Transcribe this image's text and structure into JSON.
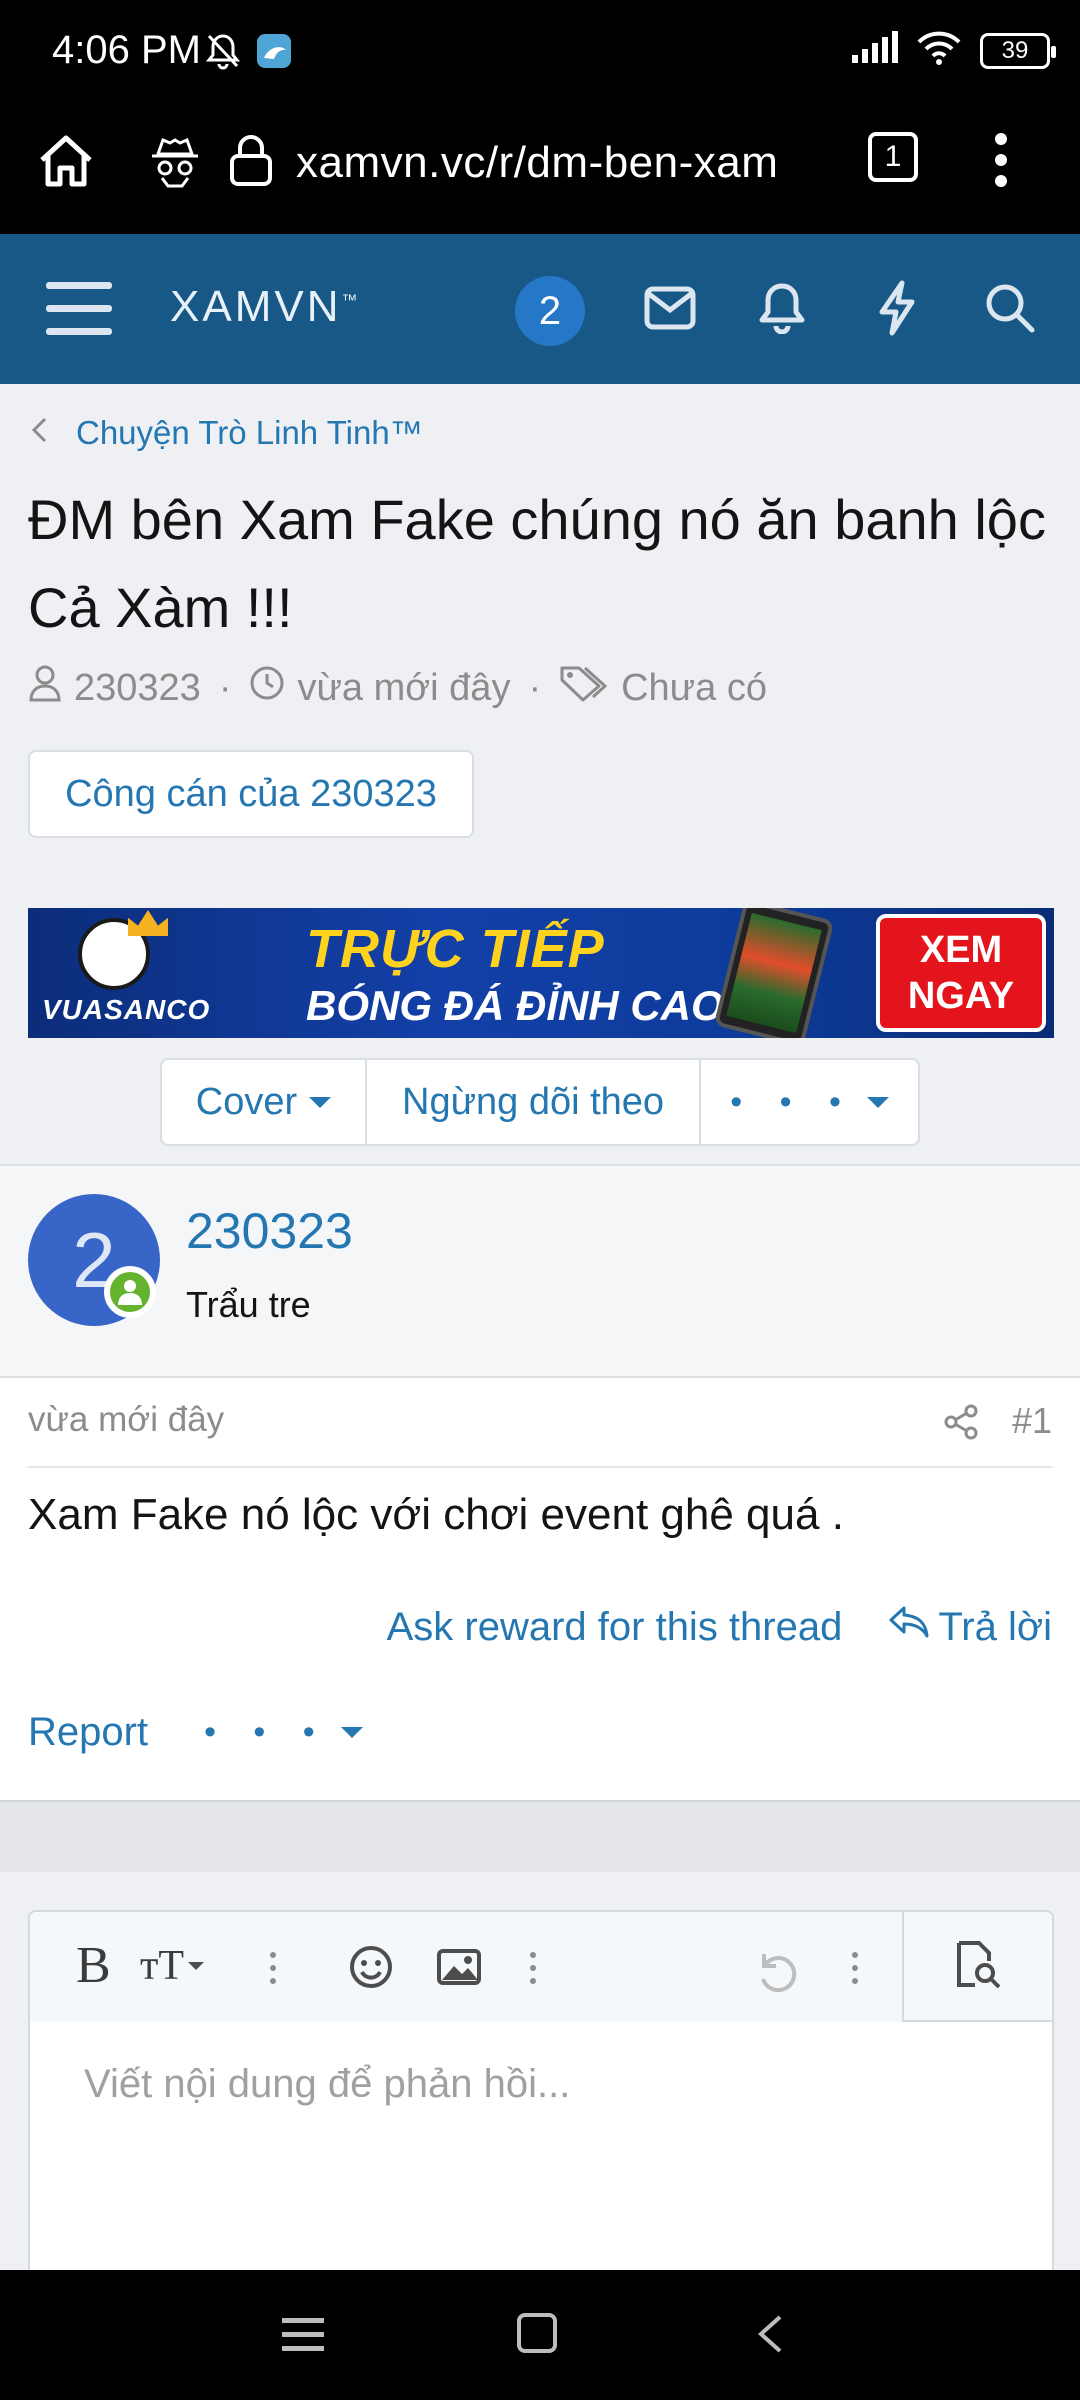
{
  "status_bar": {
    "time": "4:06 PM",
    "battery": "39"
  },
  "browser": {
    "url": "xamvn.vc/r/dm-ben-xam",
    "tab_count": "1"
  },
  "site_header": {
    "logo": "XAMVN",
    "logo_tm": "™",
    "notification_count": "2"
  },
  "breadcrumb": {
    "label": "Chuyện Trò Linh Tinh™"
  },
  "thread": {
    "title": "ĐM bên Xam Fake chúng nó ăn banh lộc Cả Xàm !!!",
    "author": "230323",
    "time": "vừa mới đây",
    "tags": "Chưa có",
    "author_button": "Công cán của 230323"
  },
  "ad": {
    "brand": "VUASANCO",
    "line1": "TRỰC TIẾP",
    "line2": "BÓNG ĐÁ ĐỈNH CAO",
    "cta_line1": "XEM",
    "cta_line2": "NGAY"
  },
  "thread_actions": {
    "cover": "Cover",
    "unwatch": "Ngừng dõi theo",
    "more": "• • •"
  },
  "post": {
    "avatar_letter": "2",
    "username": "230323",
    "user_title": "Trẩu tre",
    "time": "vừa mới đây",
    "number": "#1",
    "body": "Xam Fake nó lộc với chơi event ghê quá .",
    "ask_reward": "Ask reward for this thread",
    "reply": "Trả lời",
    "report": "Report",
    "more": "• • •"
  },
  "editor": {
    "bold": "B",
    "text_size": "тT",
    "placeholder": "Viết nội dung để phản hồi..."
  },
  "colors": {
    "header_blue": "#185886",
    "link_blue": "#2577b1",
    "badge_blue": "#2577c8",
    "avatar_blue": "#3866c8",
    "online_green": "#63b32e"
  }
}
